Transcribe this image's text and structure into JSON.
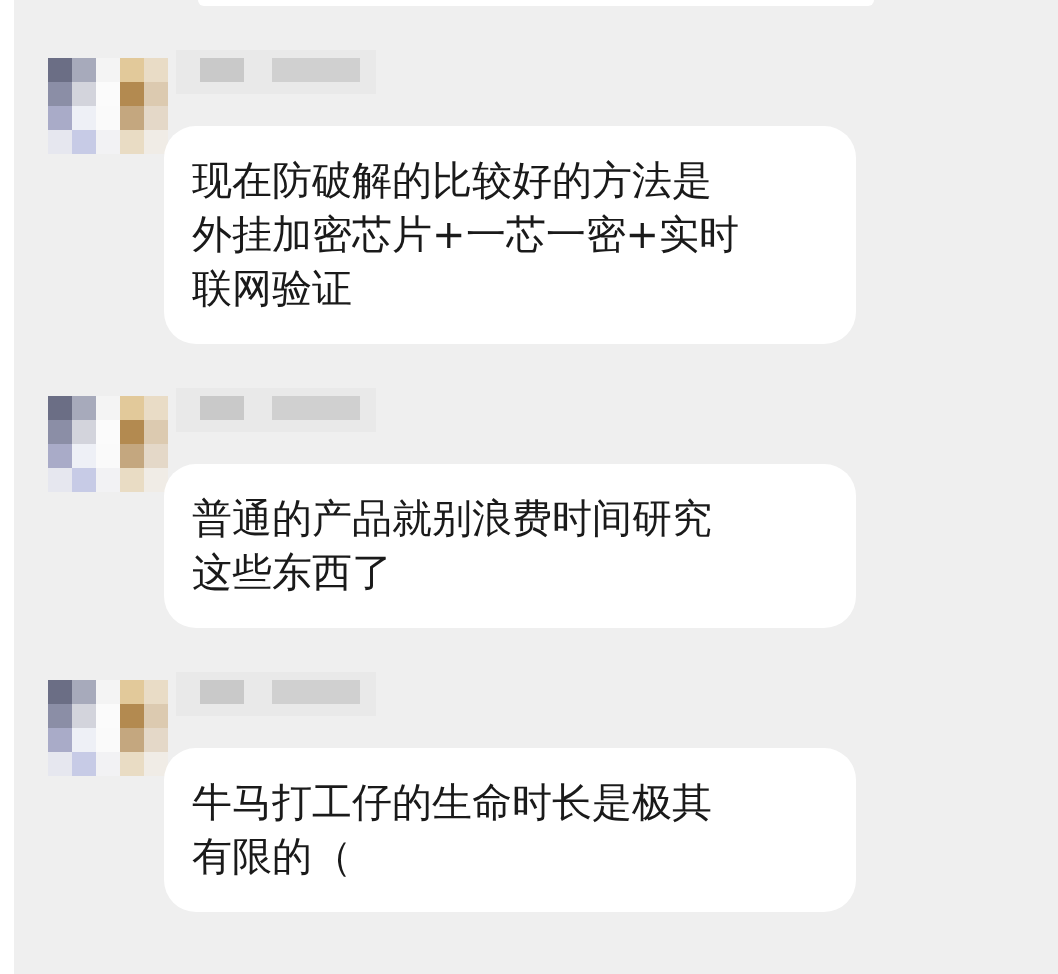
{
  "messages": [
    {
      "lines": [
        "现在防破解的比较好的方法是",
        "外挂加密芯片+一芯一密+实时",
        "联网验证"
      ]
    },
    {
      "lines": [
        "普通的产品就别浪费时间研究",
        "这些东西了"
      ]
    },
    {
      "lines": [
        "牛马打工仔的生命时长是极其",
        "有限的（"
      ]
    }
  ]
}
